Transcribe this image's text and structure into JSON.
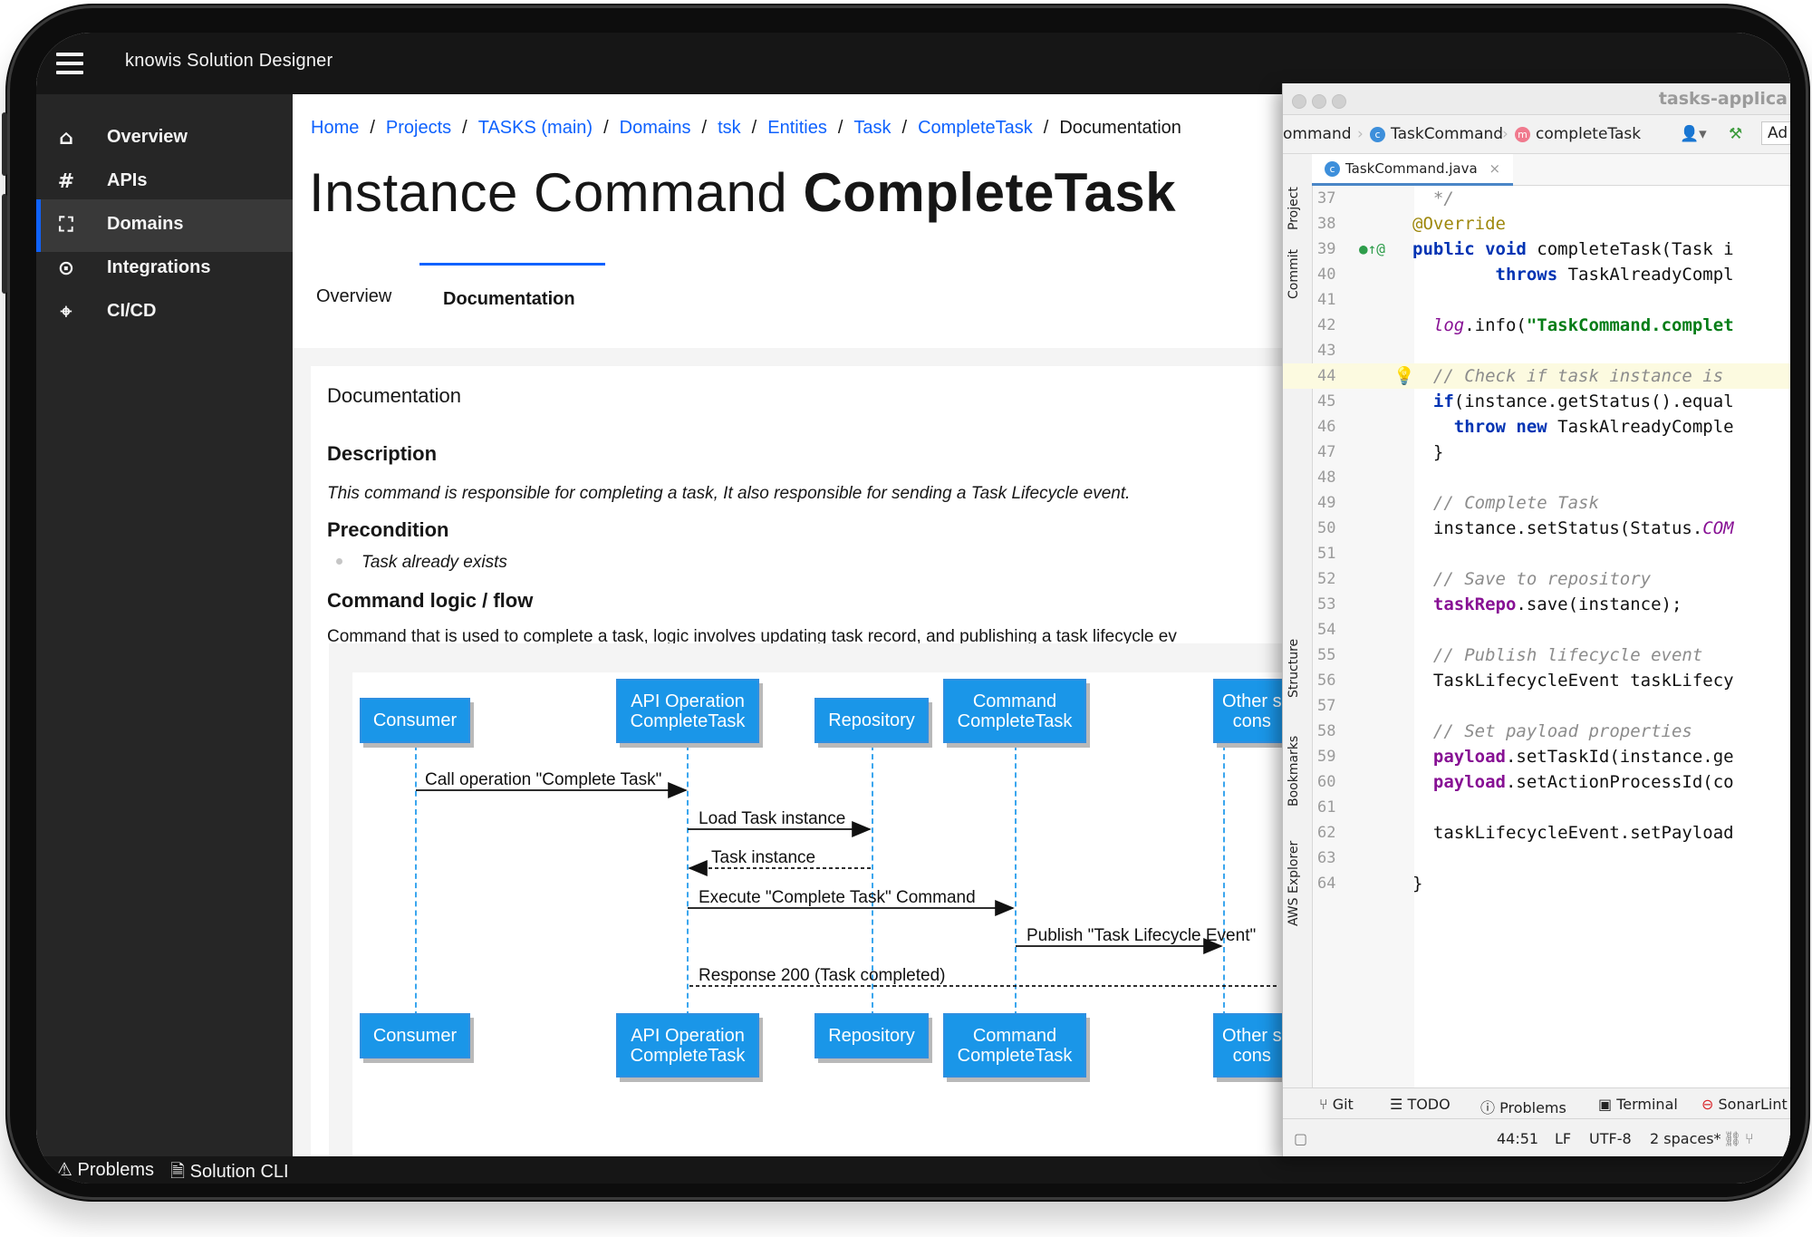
{
  "app": {
    "title": "knowis Solution Designer"
  },
  "sidebar": {
    "items": [
      {
        "label": "Overview",
        "icon": "home-icon"
      },
      {
        "label": "APIs",
        "icon": "hash-icon"
      },
      {
        "label": "Domains",
        "icon": "domains-icon",
        "active": true
      },
      {
        "label": "Integrations",
        "icon": "integration-icon"
      },
      {
        "label": "CI/CD",
        "icon": "target-icon"
      }
    ]
  },
  "breadcrumb": {
    "items": [
      "Home",
      "Projects",
      "TASKS (main)",
      "Domains",
      "tsk",
      "Entities",
      "Task",
      "CompleteTask"
    ],
    "current": "Documentation"
  },
  "page": {
    "title_prefix": "Instance Command",
    "title_name": "CompleteTask",
    "tabs": [
      "Overview",
      "Documentation"
    ],
    "active_tab": "Documentation"
  },
  "doc": {
    "heading": "Documentation",
    "description_title": "Description",
    "description_text": "This command is responsible for completing a task, It also responsible for sending a Task Lifecycle event.",
    "precondition_title": "Precondition",
    "precondition_item": "Task already exists",
    "logic_title": "Command logic / flow",
    "logic_text": "Command that is used to complete a task, logic involves updating task record, and publishing a task lifecycle ev"
  },
  "diagram": {
    "participants": [
      "Consumer",
      "API Operation\nCompleteTask",
      "Repository",
      "Command\nCompleteTask",
      "Other s\ncons"
    ],
    "messages": [
      "Call operation \"Complete Task\"",
      "Load Task instance",
      "Task instance",
      "Execute \"Complete Task\" Command",
      "Publish \"Task Lifecycle Event\"",
      "Response 200 (Task completed)"
    ]
  },
  "bottom_bar": {
    "problems": "Problems",
    "cli": "Solution CLI"
  },
  "ide": {
    "window_title": "tasks-applica",
    "nav": {
      "crumb1": "ommand",
      "crumb2": "TaskCommand",
      "crumb3": "completeTask",
      "add_label": "Ad"
    },
    "file_tab": "TaskCommand.java",
    "side_tools": [
      "Project",
      "Commit",
      "Structure",
      "Bookmarks",
      "AWS Explorer"
    ],
    "line_numbers": [
      "37",
      "38",
      "39",
      "40",
      "41",
      "42",
      "43",
      "44",
      "45",
      "46",
      "47",
      "48",
      "49",
      "50",
      "51",
      "52",
      "53",
      "54",
      "55",
      "56",
      "57",
      "58",
      "59",
      "60",
      "61",
      "62",
      "63",
      "64"
    ],
    "tools": [
      "Git",
      "TODO",
      "Problems",
      "Terminal",
      "SonarLint"
    ],
    "status": {
      "position": "44:51",
      "line_sep": "LF",
      "encoding": "UTF-8",
      "indent": "2 spaces*"
    }
  },
  "colors": {
    "accent": "#0f62fe",
    "diagram_blue": "#1a96e8",
    "sidebar": "#262626",
    "header": "#161616"
  }
}
